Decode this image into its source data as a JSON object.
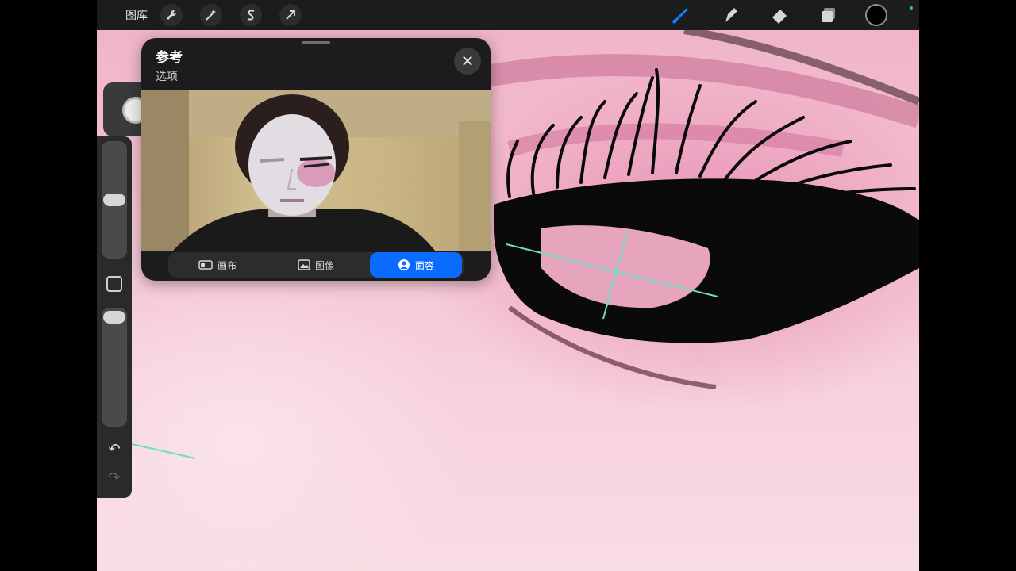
{
  "toolbar": {
    "gallery_label": "图库",
    "left_tools": [
      {
        "name": "actions",
        "icon": "wrench-icon"
      },
      {
        "name": "adjustments",
        "icon": "magic-wand-icon"
      },
      {
        "name": "selection",
        "icon": "selection-s-icon"
      },
      {
        "name": "transform",
        "icon": "arrow-cursor-icon"
      }
    ],
    "right_tools": [
      {
        "name": "brush",
        "icon": "brush-icon",
        "active": true
      },
      {
        "name": "smudge",
        "icon": "smudge-icon"
      },
      {
        "name": "eraser",
        "icon": "eraser-icon"
      },
      {
        "name": "layers",
        "icon": "layers-icon"
      }
    ],
    "current_color": "#000000",
    "accent_color": "#0a84ff"
  },
  "reference": {
    "title": "参考",
    "options_label": "选项",
    "close_glyph": "✕",
    "tabs": [
      {
        "label": "画布",
        "icon": "canvas-icon",
        "active": false
      },
      {
        "label": "图像",
        "icon": "image-icon",
        "active": false
      },
      {
        "label": "面容",
        "icon": "face-icon",
        "active": true
      }
    ]
  },
  "sidebar": {
    "undo_glyph": "↶",
    "redo_glyph": "↷"
  }
}
